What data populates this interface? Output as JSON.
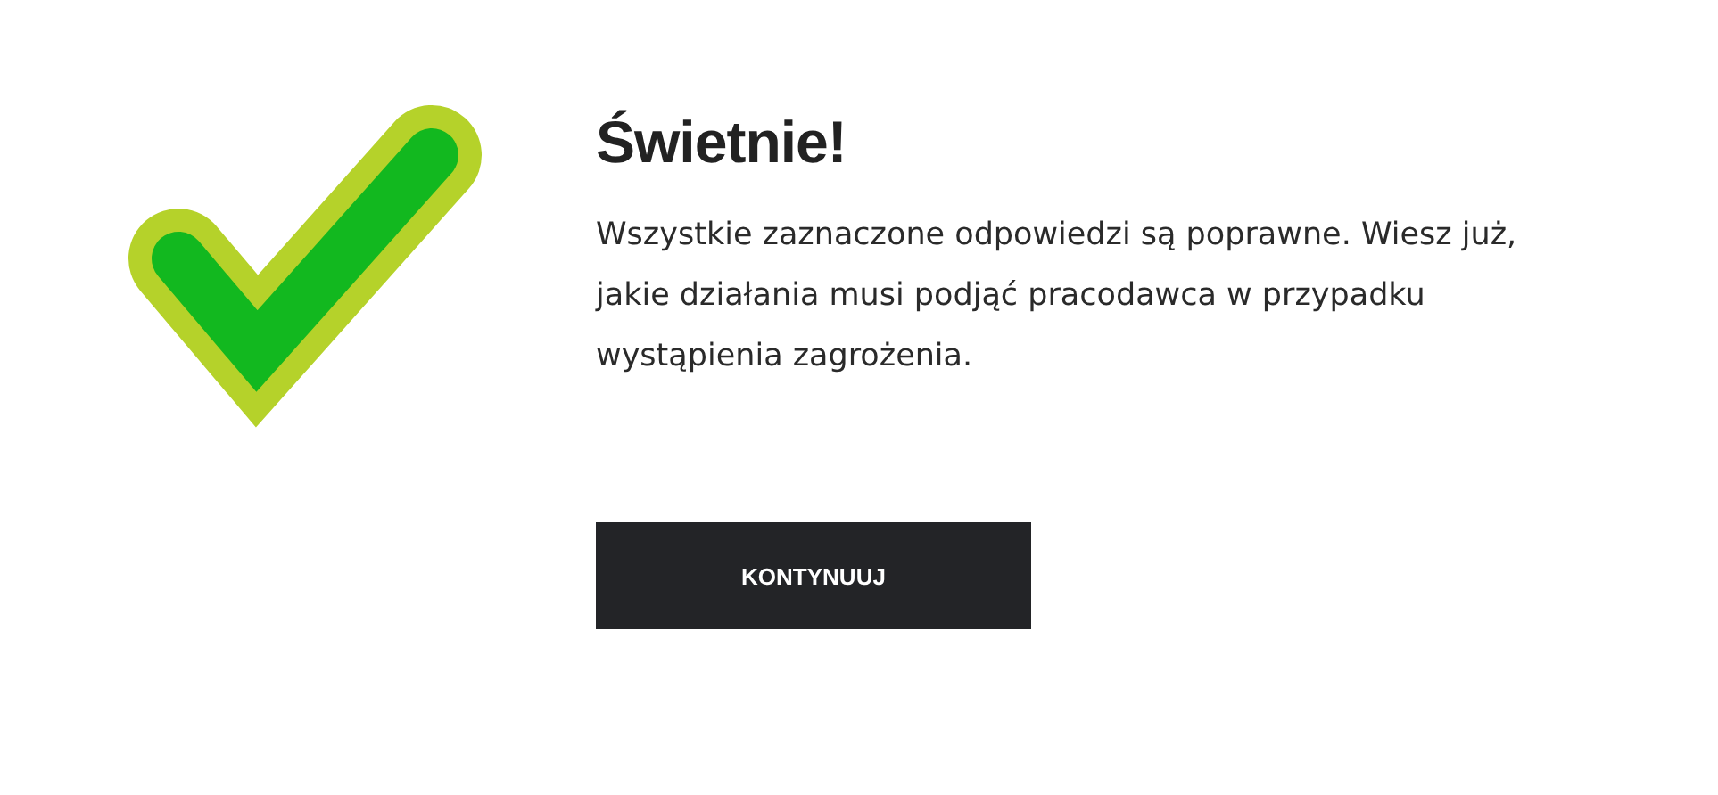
{
  "result": {
    "kind": "success",
    "title": "Świetnie!",
    "message": "Wszystkie zaznaczone odpowiedzi są poprawne. Wiesz już, jakie działania musi podjąć pracodawca w przypadku wystąpienia zagrożenia.",
    "button": "KONTYNUUJ"
  }
}
